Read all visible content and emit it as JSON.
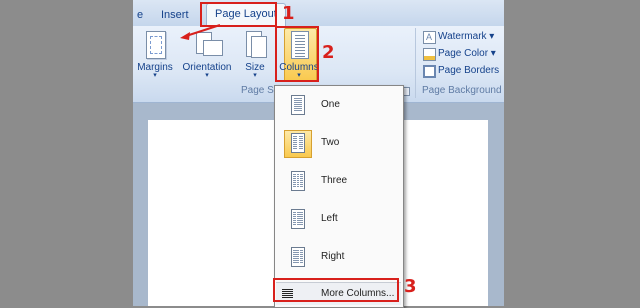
{
  "tabs": {
    "cut_left": "e",
    "insert": "Insert",
    "active": "Page Layout"
  },
  "page_setup": {
    "margins": "Margins",
    "orientation": "Orientation",
    "size": "Size",
    "columns": "Columns",
    "group_label": "Page Se"
  },
  "page_background": {
    "watermark": "Watermark ▾",
    "page_color": "Page Color ▾",
    "page_borders": "Page Borders",
    "group_label": "Page Background"
  },
  "columns_menu": {
    "items": [
      "One",
      "Two",
      "Three",
      "Left",
      "Right"
    ],
    "selected": "Two",
    "more": "More Columns..."
  },
  "callouts": [
    "1",
    "2",
    "3"
  ],
  "colors": {
    "callout_red": "#d8201c",
    "ribbon_blue": "#15428b",
    "highlight": "#f9c94e"
  },
  "icons": {
    "margins": "margins-icon",
    "orientation": "orientation-icon",
    "size": "size-icon",
    "columns": "columns-icon",
    "watermark": "watermark-icon",
    "page_color": "page-color-icon",
    "page_borders": "page-borders-icon"
  }
}
